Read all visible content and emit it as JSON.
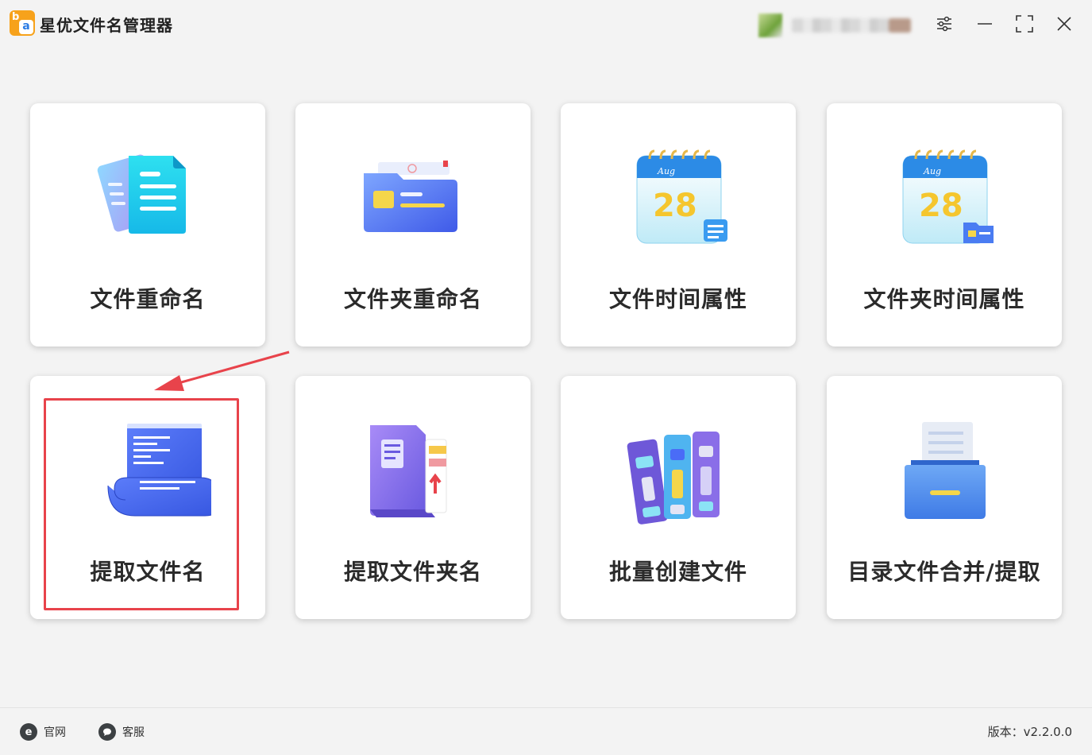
{
  "app": {
    "title": "星优文件名管理器",
    "logo_letters": {
      "top": "b",
      "bottom": "a"
    }
  },
  "window_controls": [
    "settings-icon",
    "minimize-icon",
    "maximize-icon",
    "close-icon"
  ],
  "cards": [
    {
      "label": "文件重命名",
      "icon": "documents-icon"
    },
    {
      "label": "文件夹重命名",
      "icon": "folder-icon"
    },
    {
      "label": "文件时间属性",
      "icon": "calendar-icon",
      "calendar_month": "Aug",
      "calendar_day": "28"
    },
    {
      "label": "文件夹时间属性",
      "icon": "calendar-folder-icon",
      "calendar_month": "Aug",
      "calendar_day": "28"
    },
    {
      "label": "提取文件名",
      "icon": "scroll-icon"
    },
    {
      "label": "提取文件夹名",
      "icon": "folder-extract-icon"
    },
    {
      "label": "批量创建文件",
      "icon": "binders-icon"
    },
    {
      "label": "目录文件合并/提取",
      "icon": "drawer-icon"
    }
  ],
  "footer": {
    "website_label": "官网",
    "support_label": "客服",
    "version": "版本：v2.2.0.0"
  },
  "colors": {
    "highlight": "#e8434b",
    "accent_blue": "#4a6cf7",
    "logo_orange": "#f7a21b"
  }
}
